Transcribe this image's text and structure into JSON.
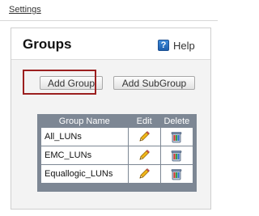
{
  "breadcrumb": {
    "label": "Settings"
  },
  "panel": {
    "title": "Groups",
    "help_label": "Help",
    "help_icon": "help-icon"
  },
  "toolbar": {
    "add_group_label": "Add Group",
    "add_subgroup_label": "Add SubGroup"
  },
  "table": {
    "columns": [
      "Group Name",
      "Edit",
      "Delete"
    ],
    "rows": [
      {
        "name": "All_LUNs"
      },
      {
        "name": "EMC_LUNs"
      },
      {
        "name": "Equallogic_LUNs"
      }
    ],
    "edit_icon": "pencil-icon",
    "delete_icon": "trash-icon"
  },
  "colors": {
    "highlight": "#9b1f1f",
    "table_header_bg": "#7d8794",
    "help_icon_blue": "#2a73c6"
  }
}
